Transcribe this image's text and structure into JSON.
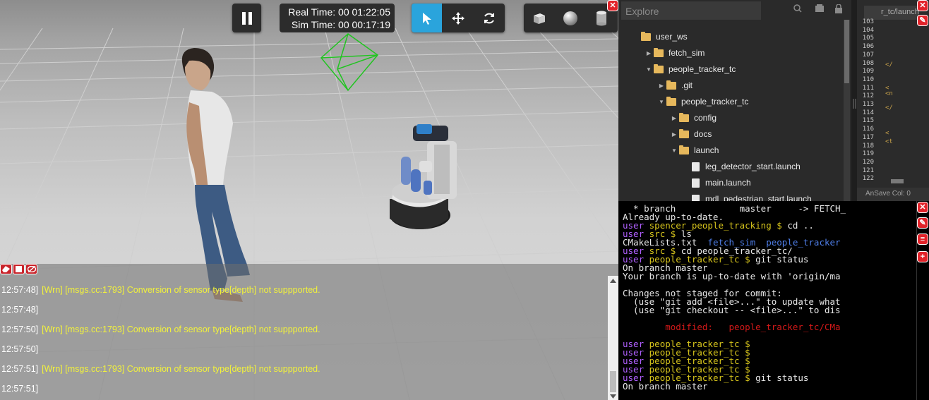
{
  "viewport": {
    "real_time_label": "Real Time:",
    "real_time": "00 01:22:05",
    "sim_time_label": "Sim Time:",
    "sim_time": "00 00:17:19",
    "toolbar_icons": [
      "pause-icon",
      "select-arrow-icon",
      "translate-icon",
      "rotate-icon",
      "box-icon",
      "sphere-icon",
      "cylinder-icon"
    ],
    "accent_color": "#2aa4dc"
  },
  "console": {
    "lines": [
      {
        "time": "12:57:48]",
        "msg": "[Wrn] [msgs.cc:1793] Conversion of sensor type[depth] not suppported."
      },
      {
        "time": "12:57:48]",
        "msg": ""
      },
      {
        "time": "12:57:50]",
        "msg": "[Wrn] [msgs.cc:1793] Conversion of sensor type[depth] not suppported."
      },
      {
        "time": "12:57:50]",
        "msg": ""
      },
      {
        "time": "12:57:51]",
        "msg": "[Wrn] [msgs.cc:1793] Conversion of sensor type[depth] not suppported."
      },
      {
        "time": "12:57:51]",
        "msg": ""
      }
    ]
  },
  "explorer": {
    "title": "Explore",
    "tree": [
      {
        "label": "user_ws",
        "type": "folder",
        "caret": ""
      },
      {
        "label": "fetch_sim",
        "type": "folder",
        "caret": "right"
      },
      {
        "label": "people_tracker_tc",
        "type": "folder",
        "caret": "down"
      },
      {
        "label": ".git",
        "type": "folder",
        "caret": "right"
      },
      {
        "label": "people_tracker_tc",
        "type": "folder",
        "caret": "down"
      },
      {
        "label": "config",
        "type": "folder",
        "caret": "right"
      },
      {
        "label": "docs",
        "type": "folder",
        "caret": "right"
      },
      {
        "label": "launch",
        "type": "folder",
        "caret": "down"
      },
      {
        "label": "leg_detector_start.launch",
        "type": "file",
        "caret": ""
      },
      {
        "label": "main.launch",
        "type": "file",
        "caret": ""
      },
      {
        "label": "mdl_pedestrian_start.launch",
        "type": "file",
        "caret": ""
      }
    ]
  },
  "editor": {
    "tab_label": "r_tc/launch",
    "line_numbers": [
      "103",
      "104",
      "105",
      "106",
      "107",
      "108",
      "109",
      "110",
      "111",
      "112",
      "113",
      "114",
      "115",
      "116",
      "117",
      "118",
      "119",
      "120",
      "121",
      "122"
    ],
    "status": "AnSave  Col: 0"
  },
  "terminal": {
    "lines": [
      {
        "segs": [
          {
            "t": "  * branch            master     -> FETCH_",
            "c": ""
          }
        ]
      },
      {
        "segs": [
          {
            "t": "Already up-to-date.",
            "c": ""
          }
        ]
      },
      {
        "segs": [
          {
            "t": "user ",
            "c": "u"
          },
          {
            "t": "spencer_people_tracking $ ",
            "c": "p"
          },
          {
            "t": "cd ..",
            "c": ""
          }
        ]
      },
      {
        "segs": [
          {
            "t": "user ",
            "c": "u"
          },
          {
            "t": "src $ ",
            "c": "p"
          },
          {
            "t": "ls",
            "c": ""
          }
        ]
      },
      {
        "segs": [
          {
            "t": "CMakeLists.txt  ",
            "c": ""
          },
          {
            "t": "fetch_sim  people_tracker",
            "c": "b"
          }
        ]
      },
      {
        "segs": [
          {
            "t": "user ",
            "c": "u"
          },
          {
            "t": "src $ ",
            "c": "p"
          },
          {
            "t": "cd people_tracker_tc/",
            "c": ""
          }
        ]
      },
      {
        "segs": [
          {
            "t": "user ",
            "c": "u"
          },
          {
            "t": "people_tracker_tc $ ",
            "c": "p"
          },
          {
            "t": "git status",
            "c": ""
          }
        ]
      },
      {
        "segs": [
          {
            "t": "On branch master",
            "c": ""
          }
        ]
      },
      {
        "segs": [
          {
            "t": "Your branch is up-to-date with 'origin/ma",
            "c": ""
          }
        ]
      },
      {
        "segs": [
          {
            "t": "",
            "c": ""
          }
        ]
      },
      {
        "segs": [
          {
            "t": "Changes not staged for commit:",
            "c": ""
          }
        ]
      },
      {
        "segs": [
          {
            "t": "  (use \"git add <file>...\" to update what",
            "c": ""
          }
        ]
      },
      {
        "segs": [
          {
            "t": "  (use \"git checkout -- <file>...\" to dis",
            "c": ""
          }
        ]
      },
      {
        "segs": [
          {
            "t": "",
            "c": ""
          }
        ]
      },
      {
        "segs": [
          {
            "t": "        modified:   people_tracker_tc/CMa",
            "c": "r"
          }
        ]
      },
      {
        "segs": [
          {
            "t": "",
            "c": ""
          }
        ]
      },
      {
        "segs": [
          {
            "t": "user ",
            "c": "u"
          },
          {
            "t": "people_tracker_tc $",
            "c": "p"
          }
        ]
      },
      {
        "segs": [
          {
            "t": "user ",
            "c": "u"
          },
          {
            "t": "people_tracker_tc $",
            "c": "p"
          }
        ]
      },
      {
        "segs": [
          {
            "t": "user ",
            "c": "u"
          },
          {
            "t": "people_tracker_tc $",
            "c": "p"
          }
        ]
      },
      {
        "segs": [
          {
            "t": "user ",
            "c": "u"
          },
          {
            "t": "people_tracker_tc $",
            "c": "p"
          }
        ]
      },
      {
        "segs": [
          {
            "t": "user ",
            "c": "u"
          },
          {
            "t": "people_tracker_tc $ ",
            "c": "p"
          },
          {
            "t": "git status",
            "c": ""
          }
        ]
      },
      {
        "segs": [
          {
            "t": "On branch master",
            "c": ""
          }
        ]
      }
    ]
  }
}
